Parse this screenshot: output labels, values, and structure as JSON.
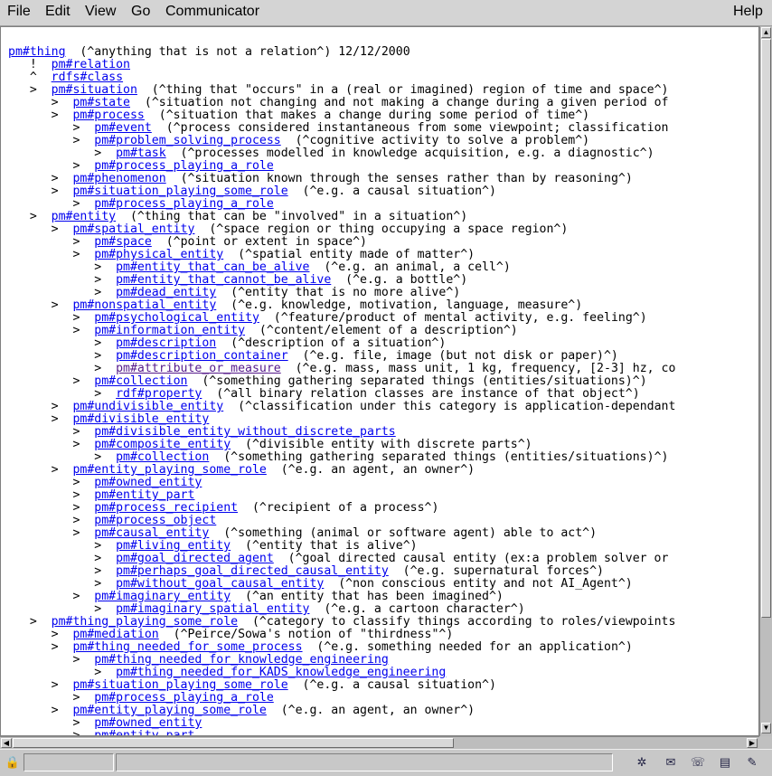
{
  "menubar": {
    "items": [
      "File",
      "Edit",
      "View",
      "Go",
      "Communicator"
    ],
    "help": "Help"
  },
  "tree": [
    {
      "ind": 0,
      "mk": "",
      "link": "pm#thing",
      "text": "  (^anything that is not a relation^) 12/12/2000"
    },
    {
      "ind": 3,
      "mk": "!  ",
      "link": "pm#relation",
      "text": ""
    },
    {
      "ind": 3,
      "mk": "^  ",
      "link": "rdfs#class",
      "text": ""
    },
    {
      "ind": 3,
      "mk": ">  ",
      "link": "pm#situation",
      "text": "  (^thing that \"occurs\" in a (real or imagined) region of time and space^)"
    },
    {
      "ind": 6,
      "mk": ">  ",
      "link": "pm#state",
      "text": "  (^situation not changing and not making a change during a given period of"
    },
    {
      "ind": 6,
      "mk": ">  ",
      "link": "pm#process",
      "text": "  (^situation that makes a change during some period of time^)"
    },
    {
      "ind": 9,
      "mk": ">  ",
      "link": "pm#event",
      "text": "  (^process considered instantaneous from some viewpoint; classification"
    },
    {
      "ind": 9,
      "mk": ">  ",
      "link": "pm#problem_solving_process",
      "text": "  (^cognitive activity to solve a problem^)"
    },
    {
      "ind": 12,
      "mk": ">  ",
      "link": "pm#task",
      "text": "  (^processes modelled in knowledge acquisition, e.g. a diagnostic^)"
    },
    {
      "ind": 9,
      "mk": ">  ",
      "link": "pm#process_playing_a_role",
      "text": ""
    },
    {
      "ind": 6,
      "mk": ">  ",
      "link": "pm#phenomenon",
      "text": "  (^situation known through the senses rather than by reasoning^)"
    },
    {
      "ind": 6,
      "mk": ">  ",
      "link": "pm#situation_playing_some_role",
      "text": "  (^e.g. a causal situation^)"
    },
    {
      "ind": 9,
      "mk": ">  ",
      "link": "pm#process_playing_a_role",
      "text": ""
    },
    {
      "ind": 3,
      "mk": ">  ",
      "link": "pm#entity",
      "text": "  (^thing that can be \"involved\" in a situation^)"
    },
    {
      "ind": 6,
      "mk": ">  ",
      "link": "pm#spatial_entity",
      "text": "  (^space region or thing occupying a space region^)"
    },
    {
      "ind": 9,
      "mk": ">  ",
      "link": "pm#space",
      "text": "  (^point or extent in space^)"
    },
    {
      "ind": 9,
      "mk": ">  ",
      "link": "pm#physical_entity",
      "text": "  (^spatial entity made of matter^)"
    },
    {
      "ind": 12,
      "mk": ">  ",
      "link": "pm#entity_that_can_be_alive",
      "text": "  (^e.g. an animal, a cell^)"
    },
    {
      "ind": 12,
      "mk": ">  ",
      "link": "pm#entity_that_cannot_be_alive",
      "text": "  (^e.g. a bottle^)"
    },
    {
      "ind": 12,
      "mk": ">  ",
      "link": "pm#dead_entity",
      "text": "  (^entity that is no more alive^)"
    },
    {
      "ind": 6,
      "mk": ">  ",
      "link": "pm#nonspatial_entity",
      "text": "  (^e.g. knowledge, motivation, language, measure^)"
    },
    {
      "ind": 9,
      "mk": ">  ",
      "link": "pm#psychological_entity",
      "text": "  (^feature/product of mental activity, e.g. feeling^)"
    },
    {
      "ind": 9,
      "mk": ">  ",
      "link": "pm#information_entity",
      "text": "  (^content/element of a description^)"
    },
    {
      "ind": 12,
      "mk": ">  ",
      "link": "pm#description",
      "text": "  (^description of a situation^)"
    },
    {
      "ind": 12,
      "mk": ">  ",
      "link": "pm#description_container",
      "text": "  (^e.g. file, image (but not disk or paper)^)"
    },
    {
      "ind": 12,
      "mk": ">  ",
      "link": "pm#attribute_or_measure",
      "visited": true,
      "text": "  (^e.g. mass, mass unit, 1 kg, frequency, [2-3] hz, co"
    },
    {
      "ind": 9,
      "mk": ">  ",
      "link": "pm#collection",
      "text": "  (^something gathering separated things (entities/situations)^)"
    },
    {
      "ind": 12,
      "mk": ">  ",
      "link": "rdf#property",
      "text": "  (^all binary relation classes are instance of that object^)"
    },
    {
      "ind": 6,
      "mk": ">  ",
      "link": "pm#undivisible_entity",
      "text": "  (^classification under this category is application-dependant"
    },
    {
      "ind": 6,
      "mk": ">  ",
      "link": "pm#divisible_entity",
      "text": ""
    },
    {
      "ind": 9,
      "mk": ">  ",
      "link": "pm#divisible_entity_without_discrete_parts",
      "text": ""
    },
    {
      "ind": 9,
      "mk": ">  ",
      "link": "pm#composite_entity",
      "text": "  (^divisible entity with discrete parts^)"
    },
    {
      "ind": 12,
      "mk": ">  ",
      "link": "pm#collection",
      "text": "  (^something gathering separated things (entities/situations)^)"
    },
    {
      "ind": 6,
      "mk": ">  ",
      "link": "pm#entity_playing_some_role",
      "text": "  (^e.g. an agent, an owner^)"
    },
    {
      "ind": 9,
      "mk": ">  ",
      "link": "pm#owned_entity",
      "text": ""
    },
    {
      "ind": 9,
      "mk": ">  ",
      "link": "pm#entity_part",
      "text": ""
    },
    {
      "ind": 9,
      "mk": ">  ",
      "link": "pm#process_recipient",
      "text": "  (^recipient of a process^)"
    },
    {
      "ind": 9,
      "mk": ">  ",
      "link": "pm#process_object",
      "text": ""
    },
    {
      "ind": 9,
      "mk": ">  ",
      "link": "pm#causal_entity",
      "text": "  (^something (animal or software agent) able to act^)"
    },
    {
      "ind": 12,
      "mk": ">  ",
      "link": "pm#living_entity",
      "text": "  (^entity that is alive^)"
    },
    {
      "ind": 12,
      "mk": ">  ",
      "link": "pm#goal_directed_agent",
      "text": "  (^goal directed causal entity (ex:a problem solver or"
    },
    {
      "ind": 12,
      "mk": ">  ",
      "link": "pm#perhaps_goal_directed_causal_entity",
      "text": "  (^e.g. supernatural forces^)"
    },
    {
      "ind": 12,
      "mk": ">  ",
      "link": "pm#without_goal_causal_entity",
      "text": "  (^non conscious entity and not AI_Agent^)"
    },
    {
      "ind": 9,
      "mk": ">  ",
      "link": "pm#imaginary_entity",
      "text": "  (^an entity that has been imagined^)"
    },
    {
      "ind": 12,
      "mk": ">  ",
      "link": "pm#imaginary_spatial_entity",
      "text": "  (^e.g. a cartoon character^)"
    },
    {
      "ind": 3,
      "mk": ">  ",
      "link": "pm#thing_playing_some_role",
      "text": "  (^category to classify things according to roles/viewpoints"
    },
    {
      "ind": 6,
      "mk": ">  ",
      "link": "pm#mediation",
      "text": "  (^Peirce/Sowa's notion of \"thirdness\"^)"
    },
    {
      "ind": 6,
      "mk": ">  ",
      "link": "pm#thing_needed_for_some_process",
      "text": "  (^e.g. something needed for an application^)"
    },
    {
      "ind": 9,
      "mk": ">  ",
      "link": "pm#thing_needed_for_knowledge_engineering",
      "text": ""
    },
    {
      "ind": 12,
      "mk": ">  ",
      "link": "pm#thing_needed_for_KADS_knowledge_engineering",
      "text": ""
    },
    {
      "ind": 6,
      "mk": ">  ",
      "link": "pm#situation_playing_some_role",
      "text": "  (^e.g. a causal situation^)"
    },
    {
      "ind": 9,
      "mk": ">  ",
      "link": "pm#process_playing_a_role",
      "text": ""
    },
    {
      "ind": 6,
      "mk": ">  ",
      "link": "pm#entity_playing_some_role",
      "text": "  (^e.g. an agent, an owner^)"
    },
    {
      "ind": 9,
      "mk": ">  ",
      "link": "pm#owned_entity",
      "text": ""
    },
    {
      "ind": 9,
      "mk": ">  ",
      "link": "pm#entity_part",
      "text": ""
    }
  ],
  "statusbar": {
    "icons": [
      "security-lock-icon",
      "component-bar-icon",
      "navigator-icon",
      "mail-icon",
      "discussions-icon",
      "composer-icon",
      "edit-icon"
    ]
  }
}
